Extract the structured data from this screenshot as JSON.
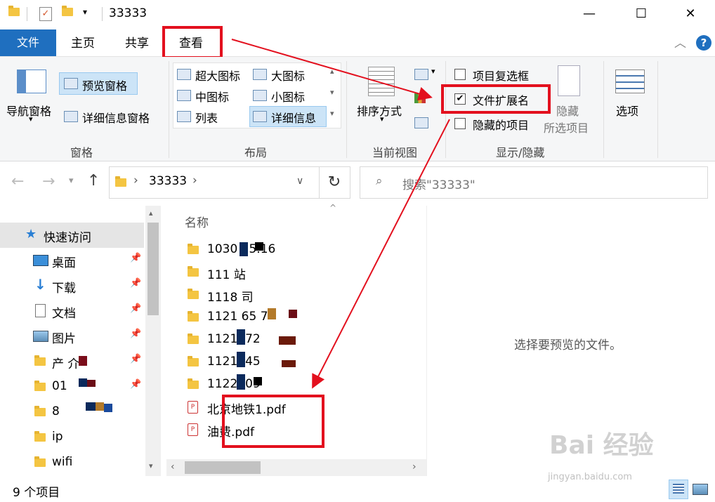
{
  "window": {
    "title": "33333",
    "minimize": "—",
    "maximize": "☐",
    "close": "✕"
  },
  "tabs": {
    "file": "文件",
    "home": "主页",
    "share": "共享",
    "view": "查看",
    "collapse": "︿",
    "help": "?"
  },
  "ribbon": {
    "pane": {
      "nav_pane": "导航窗格",
      "preview_pane": "预览窗格",
      "details_pane": "详细信息窗格",
      "group": "窗格"
    },
    "layout": {
      "xl_icons": "超大图标",
      "large_icons": "大图标",
      "medium_icons": "中图标",
      "small_icons": "小图标",
      "list": "列表",
      "details": "详细信息",
      "group": "布局"
    },
    "current_view": {
      "sort_by": "排序方式",
      "group": "当前视图"
    },
    "show_hide": {
      "item_checkboxes": "项目复选框",
      "file_extensions": "文件扩展名",
      "hidden_items": "隐藏的项目",
      "hide_selected_line1": "隐藏",
      "hide_selected_line2": "所选项目",
      "group": "显示/隐藏",
      "file_extensions_checked": "✔"
    },
    "options": "选项"
  },
  "address": {
    "path": "33333",
    "search_placeholder": "搜索\"33333\""
  },
  "nav_pane": {
    "quick_access": "快速访问",
    "items": [
      {
        "label": "桌面"
      },
      {
        "label": "下载"
      },
      {
        "label": "文档"
      },
      {
        "label": "图片"
      },
      {
        "label": "产 介"
      },
      {
        "label": "01"
      },
      {
        "label": "8"
      },
      {
        "label": "ip"
      },
      {
        "label": "wifi"
      }
    ]
  },
  "file_list": {
    "column_name": "名称",
    "rows": [
      {
        "name": "1030 15.16"
      },
      {
        "name": "111 站"
      },
      {
        "name": "1118 司"
      },
      {
        "name": "1121 65 7"
      },
      {
        "name": "1121 .72"
      },
      {
        "name": "1121 .45"
      },
      {
        "name": "1122 .09"
      },
      {
        "name": "北京地铁1.pdf"
      },
      {
        "name": "油费.pdf"
      }
    ]
  },
  "preview": {
    "message": "选择要预览的文件。"
  },
  "status": {
    "count": "9 个项目"
  },
  "watermark": {
    "brand": "Bai 经验",
    "url": "jingyan.baidu.com"
  }
}
